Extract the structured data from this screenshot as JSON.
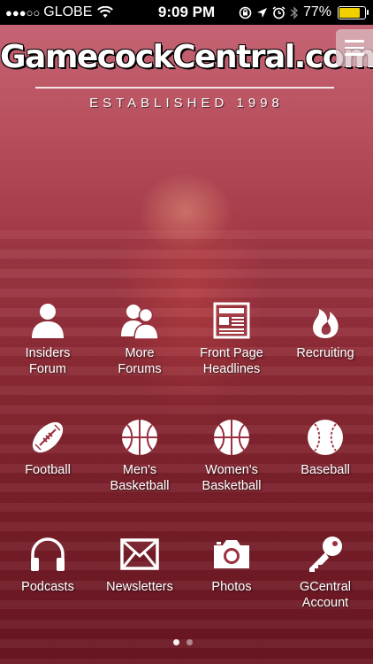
{
  "status_bar": {
    "signal_dots": "●●●○○",
    "carrier": "GLOBE",
    "time": "9:09 PM",
    "battery_percent": "77%",
    "battery_level": 0.77
  },
  "header": {
    "logo_text": "GamecockCentral.com",
    "tagline": "ESTABLISHED 1998",
    "menu_icon": "hamburger-icon"
  },
  "tiles": [
    {
      "label": "Insiders\nForum",
      "icon": "person-icon"
    },
    {
      "label": "More\nForums",
      "icon": "people-icon"
    },
    {
      "label": "Front Page\nHeadlines",
      "icon": "newspaper-icon"
    },
    {
      "label": "Recruiting",
      "icon": "flame-icon"
    },
    {
      "label": "Football",
      "icon": "football-icon"
    },
    {
      "label": "Men's\nBasketball",
      "icon": "basketball-icon"
    },
    {
      "label": "Women's\nBasketball",
      "icon": "basketball-icon"
    },
    {
      "label": "Baseball",
      "icon": "baseball-icon"
    },
    {
      "label": "Podcasts",
      "icon": "headphones-icon"
    },
    {
      "label": "Newsletters",
      "icon": "envelope-icon"
    },
    {
      "label": "Photos",
      "icon": "camera-icon"
    },
    {
      "label": "GCentral\nAccount",
      "icon": "key-icon"
    }
  ],
  "pager": {
    "pages": 2,
    "current": 1
  }
}
